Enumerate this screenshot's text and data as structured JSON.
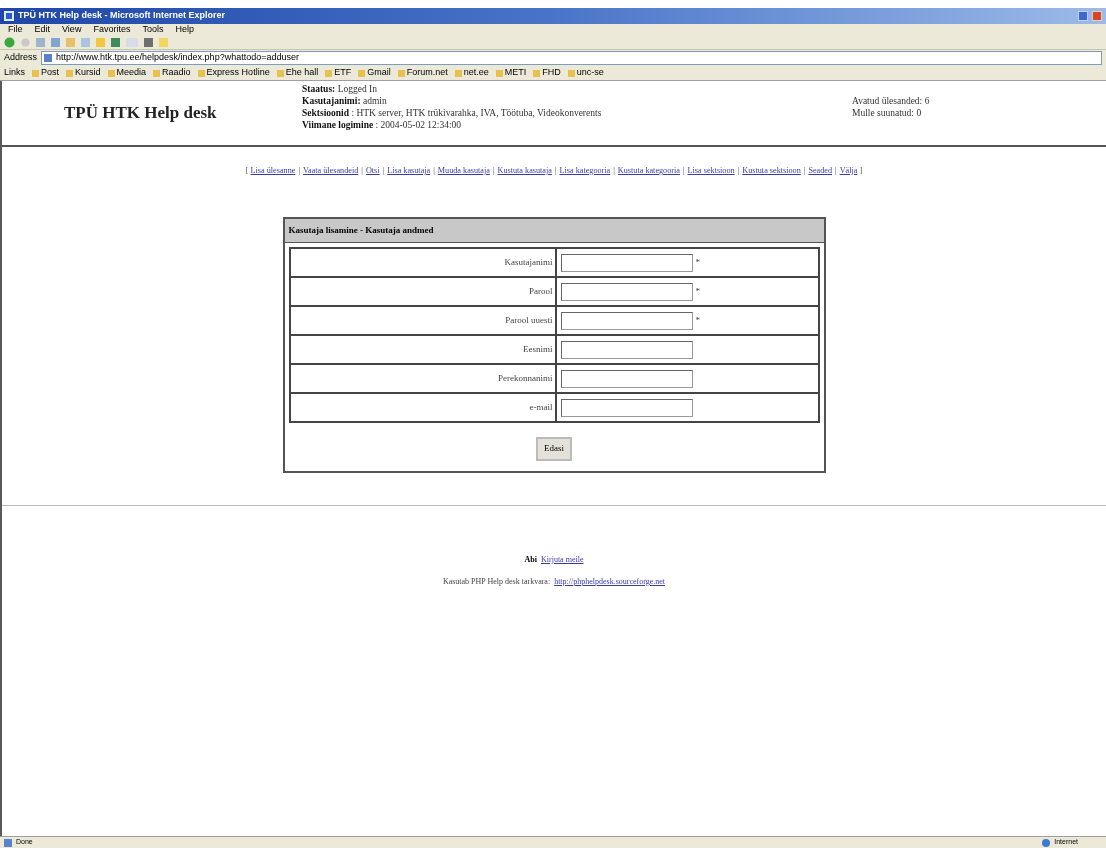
{
  "window": {
    "title": "TPÜ HTK Help desk - Microsoft Internet Explorer"
  },
  "menu": [
    "File",
    "Edit",
    "View",
    "Favorites",
    "Tools",
    "Help"
  ],
  "address": {
    "label": "Address",
    "url": "http://www.htk.tpu.ee/helpdesk/index.php?whattodo=adduser"
  },
  "links_bar": {
    "label": "Links",
    "items": [
      "Post",
      "Kursid",
      "Meedia",
      "Raadio",
      "Express Hotline",
      "Ehe hall",
      "ETF",
      "Gmail",
      "Forum.net",
      "net.ee",
      "METI",
      "FHD",
      "unc-se"
    ]
  },
  "header": {
    "logo": "TPÜ HTK Help desk",
    "info": [
      {
        "label": "Staatus:",
        "value": " Logged In"
      },
      {
        "label": "Kasutajanimi:",
        "value": " admin"
      },
      {
        "label": "Sektsioonid",
        "value": " : HTK server, HTK trükivarahka, IVA, Töötuba, Videokonverents"
      },
      {
        "label": "Viimane logimine",
        "value": " : 2004-05-02 12:34:00"
      }
    ],
    "counts": [
      "Avatud ülesanded: 6",
      "Mulle suunatud: 0"
    ]
  },
  "nav": [
    {
      "kind": "bracket",
      "text": "["
    },
    {
      "kind": "link",
      "text": "Lisa ülesanne"
    },
    {
      "kind": "separator",
      "text": "|"
    },
    {
      "kind": "link",
      "text": "Vaata ülesandeid"
    },
    {
      "kind": "separator",
      "text": "|"
    },
    {
      "kind": "link",
      "text": "Otsi"
    },
    {
      "kind": "separator",
      "text": "|"
    },
    {
      "kind": "link",
      "text": "Lisa kasutaja"
    },
    {
      "kind": "separator",
      "text": "|"
    },
    {
      "kind": "link",
      "text": "Muuda kasutaja"
    },
    {
      "kind": "separator",
      "text": "|"
    },
    {
      "kind": "link",
      "text": "Kustuta kasutaja"
    },
    {
      "kind": "separator",
      "text": "|"
    },
    {
      "kind": "link",
      "text": "Lisa kategooria"
    },
    {
      "kind": "separator",
      "text": "|"
    },
    {
      "kind": "link",
      "text": "Kustuta kategooria"
    },
    {
      "kind": "separator",
      "text": "|"
    },
    {
      "kind": "link",
      "text": "Lisa sektsioon"
    },
    {
      "kind": "separator",
      "text": "|"
    },
    {
      "kind": "link",
      "text": "Kustuta sektsioon"
    },
    {
      "kind": "separator",
      "text": "|"
    },
    {
      "kind": "link",
      "text": "Seaded"
    },
    {
      "kind": "separator",
      "text": "|"
    },
    {
      "kind": "link",
      "text": "Välja"
    },
    {
      "kind": "bracket",
      "text": "]"
    }
  ],
  "form": {
    "title": "Kasutaja lisamine - Kasutaja andmed",
    "fields": [
      {
        "label": "Kasutajanimi",
        "required": true
      },
      {
        "label": "Parool",
        "required": true
      },
      {
        "label": "Parool uuesti",
        "required": true
      },
      {
        "label": "Eesnimi",
        "required": false
      },
      {
        "label": "Perekonnanimi",
        "required": false
      },
      {
        "label": "e-mail",
        "required": false
      }
    ],
    "required_mark": "*",
    "submit": "Edasi"
  },
  "footer": {
    "help_label": "Abi",
    "help_link": "Kirjuta meile",
    "credit": "Kasutab PHP Help desk tarkvara:",
    "credit_link": "http://phphelpdesk.sourceforge.net"
  },
  "status_bar": {
    "text": "Done",
    "zone": "Internet"
  }
}
